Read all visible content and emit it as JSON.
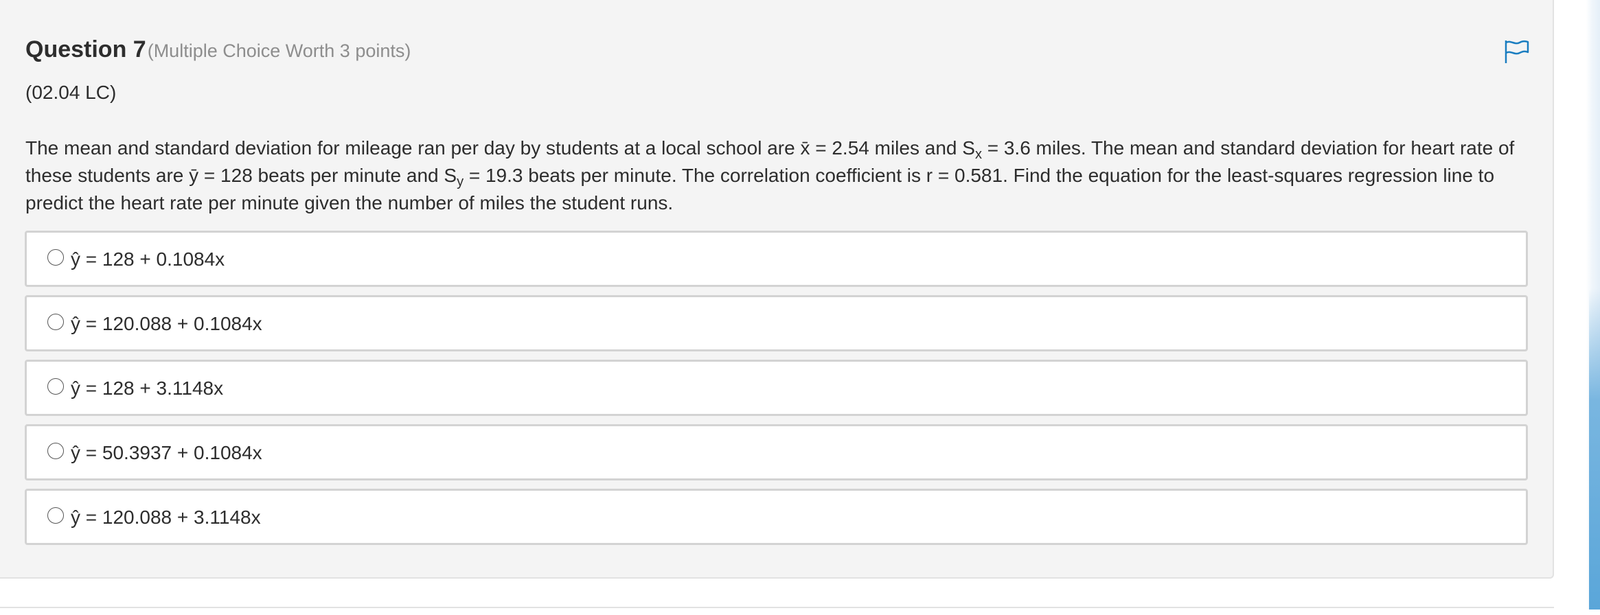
{
  "question": {
    "title": "Question 7",
    "meta": "(Multiple Choice Worth 3 points)",
    "code": "(02.04 LC)",
    "body": {
      "p1": "The mean and standard deviation for mileage ran per day by students at a local school are x̄ = 2.54 miles and S",
      "sub_x": "x",
      "p2": " = 3.6 miles. The mean and standard deviation for heart rate of these students are ȳ = 128 beats per minute and S",
      "sub_y": "y",
      "p3": " = 19.3 beats per minute. The correlation coefficient is r = 0.581. Find the equation for the least-squares regression line to predict the heart rate per minute given the number of miles the student runs."
    }
  },
  "options": [
    {
      "label": "ŷ = 128 + 0.1084x",
      "selected": false
    },
    {
      "label": "ŷ = 120.088 + 0.1084x",
      "selected": false
    },
    {
      "label": "ŷ = 128 + 3.1148x",
      "selected": false
    },
    {
      "label": "ŷ = 50.3937 + 0.1084x",
      "selected": false
    },
    {
      "label": "ŷ = 120.088 + 3.1148x",
      "selected": false
    }
  ],
  "icons": {
    "flag": "flag-icon",
    "radio": "radio-unchecked-icon"
  },
  "colors": {
    "accent": "#1a7dc0",
    "panel_bg": "#f4f4f4",
    "option_border": "#d3d3d3"
  }
}
